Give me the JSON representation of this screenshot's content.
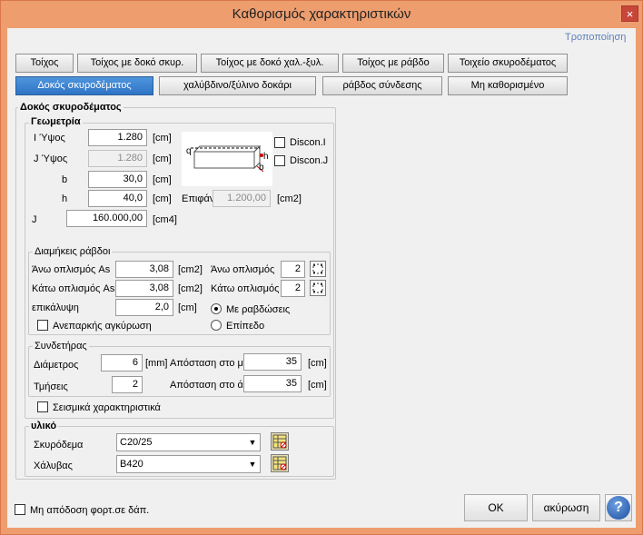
{
  "window": {
    "title": "Καθορισμός χαρακτηριστικών",
    "close": "×"
  },
  "link": "Τροποποίηση",
  "tabs_row1": [
    "Τοίχος",
    "Τοίχος με δοκό σκυρ.",
    "Τοίχος με δοκό χαλ.-ξυλ.",
    "Τοίχος με ράβδο",
    "Τοιχείο σκυροδέματος"
  ],
  "tabs_row2": [
    "Δοκός σκυροδέματος",
    "χαλύβδινο/ξύλινο δοκάρι",
    "ράβδος σύνδεσης",
    "Μη καθορισμένο"
  ],
  "section_title": "Δοκός σκυροδέματος",
  "geometry": {
    "title": "Γεωμετρία",
    "i_height_label": "I Ύψος",
    "i_height_value": "1.280",
    "i_height_unit": "[cm]",
    "j_height_label": "J Ύψος",
    "j_height_value": "1.280",
    "j_height_unit": "[cm]",
    "b_label": "b",
    "b_value": "30,0",
    "b_unit": "[cm]",
    "h_label": "h",
    "h_value": "40,0",
    "h_unit": "[cm]",
    "area_label": "Επιφάν",
    "area_value": "1.200,00",
    "area_unit": "[cm2]",
    "j_label": "J",
    "j_value": "160.000,00",
    "j_unit": "[cm4]",
    "discon_i": "Discon.I",
    "discon_j": "Discon.J",
    "diagram_q": "q",
    "diagram_h": "h",
    "diagram_b": "b"
  },
  "rebar": {
    "title": "Διαμήκεις ράβδοι",
    "top_label": "Άνω οπλισμός As",
    "top_value": "3,08",
    "top_unit": "[cm2]",
    "top_count_label": "Άνω οπλισμός",
    "top_count": "2",
    "bottom_label": "Κάτω οπλισμός As",
    "bottom_value": "3,08",
    "bottom_unit": "[cm2]",
    "bottom_count_label": "Κάτω οπλισμός",
    "bottom_count": "2",
    "cover_label": "επικάλυψη",
    "cover_value": "2,0",
    "cover_unit": "[cm]",
    "radio_bars": "Με ραβδώσεις",
    "radio_plain": "Επίπεδο",
    "anchorage": "Ανεπαρκής αγκύρωση"
  },
  "stirrups": {
    "title": "Συνδετήρας",
    "diameter_label": "Διάμετρος",
    "diameter_value": "6",
    "diameter_unit": "[mm]",
    "spacing_mid_label": "Απόσταση στο μέ",
    "spacing_mid_value": "35",
    "spacing_mid_unit": "[cm]",
    "legs_label": "Τμήσεις",
    "legs_value": "2",
    "spacing_end_label": "Απόσταση στο άκ",
    "spacing_end_value": "35",
    "spacing_end_unit": "[cm]"
  },
  "seismic": "Σεισμικά χαρακτηριστικά",
  "material": {
    "title": "υλικό",
    "concrete_label": "Σκυρόδεμα",
    "concrete_value": "C20/25",
    "steel_label": "Χάλυβας",
    "steel_value": "B420"
  },
  "footer": {
    "no_load": "Μη απόδοση φορτ.σε δάπ.",
    "ok": "OK",
    "cancel": "ακύρωση",
    "help": "?"
  },
  "colors": {
    "accent": "#2e74c5",
    "title_bg": "#ed9d6e",
    "close": "#c7463a"
  }
}
